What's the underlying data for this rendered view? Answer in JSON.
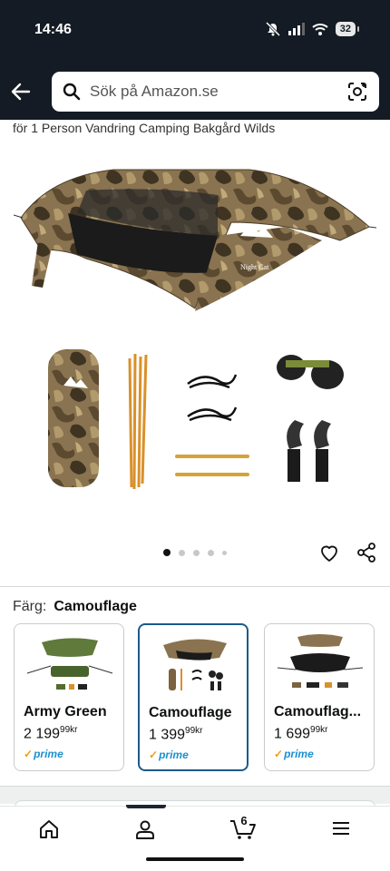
{
  "status_bar": {
    "time": "14:46",
    "battery": "32"
  },
  "search": {
    "placeholder": "Sök på Amazon.se"
  },
  "product": {
    "title": "för 1 Person Vandring Camping Bakgård Wilds",
    "brand_logo_text": "Night Cat"
  },
  "gallery": {
    "total_images": 5,
    "active_index": 0
  },
  "variant": {
    "label": "Färg:",
    "selected": "Camouflage",
    "options": [
      {
        "name": "Army Green",
        "price_main": "2 199",
        "price_cents": "99",
        "currency": "kr",
        "prime": "prime",
        "selected": false
      },
      {
        "name": "Camouflage",
        "price_main": "1 399",
        "price_cents": "99",
        "currency": "kr",
        "prime": "prime",
        "selected": true
      },
      {
        "name": "Camouflag...",
        "price_main": "1 699",
        "price_cents": "99",
        "currency": "kr",
        "prime": "prime",
        "selected": false
      }
    ]
  },
  "bottom_nav": {
    "cart_count": "6",
    "active_tab": "account"
  },
  "colors": {
    "header_bg": "#141b24",
    "selected_border": "#1c5a8a",
    "prime_blue": "#1b8fd2"
  }
}
